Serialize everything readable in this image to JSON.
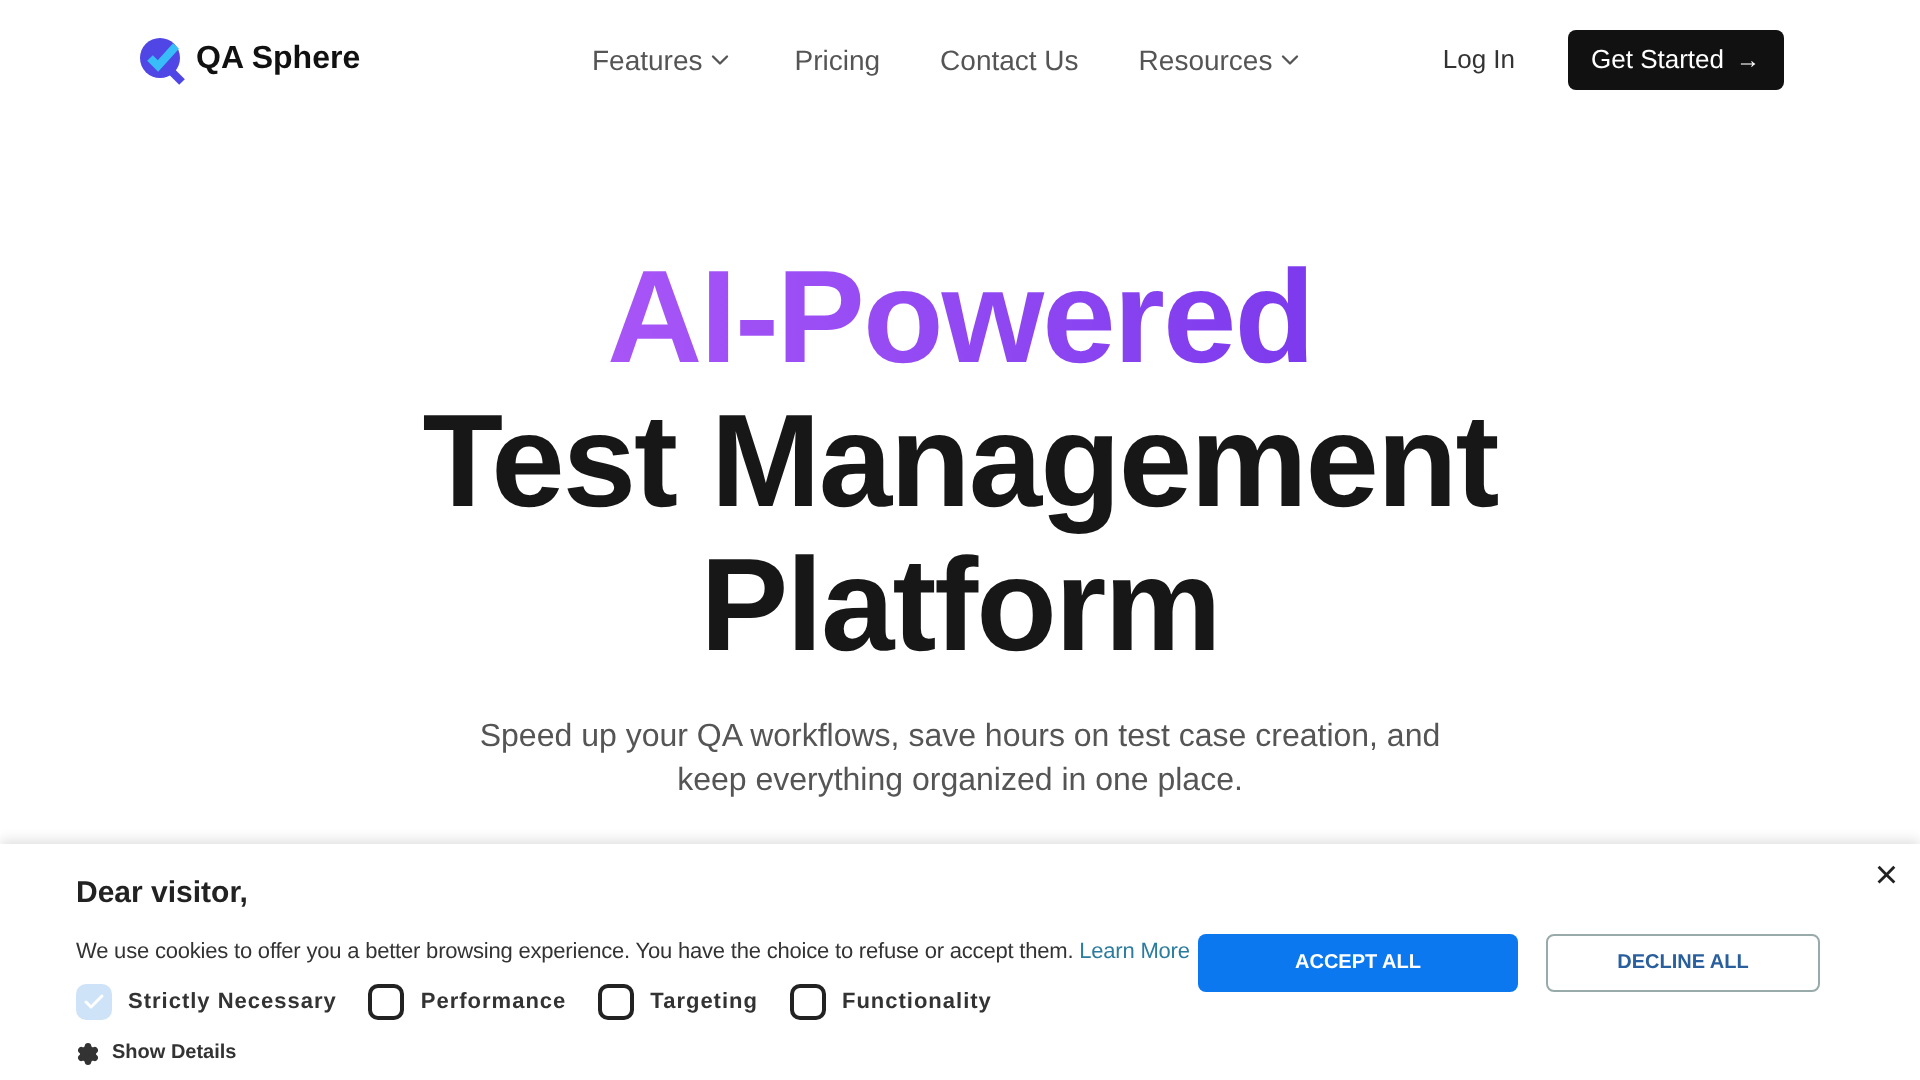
{
  "brand": {
    "name": "QA Sphere"
  },
  "nav": [
    {
      "label": "Features",
      "kind": "dropdown"
    },
    {
      "label": "Pricing",
      "kind": "link"
    },
    {
      "label": "Contact Us",
      "kind": "link"
    },
    {
      "label": "Resources",
      "kind": "dropdown"
    }
  ],
  "login": "Log In",
  "cta": {
    "label": "Get Started",
    "arrow": "→"
  },
  "hero": {
    "highlight": "AI-Powered",
    "title_lines": [
      "Test Management",
      "Platform"
    ],
    "subtitle_lines": [
      "Speed up your QA workflows, save hours on test case creation, and",
      "keep everything organized in one place."
    ]
  },
  "cookie_banner": {
    "title": "Dear visitor,",
    "text": "We use cookies to offer you a better browsing experience. You have the choice to refuse or accept them.",
    "link": "Learn More",
    "options": [
      {
        "label": "Strictly Necessary",
        "checked": true,
        "disabled": true
      },
      {
        "label": "Performance",
        "checked": false,
        "disabled": false
      },
      {
        "label": "Targeting",
        "checked": false,
        "disabled": false
      },
      {
        "label": "Functionality",
        "checked": false,
        "disabled": false
      }
    ],
    "details": "Show Details",
    "accept": "ACCEPT ALL",
    "decline": "DECLINE ALL",
    "close": "×"
  }
}
